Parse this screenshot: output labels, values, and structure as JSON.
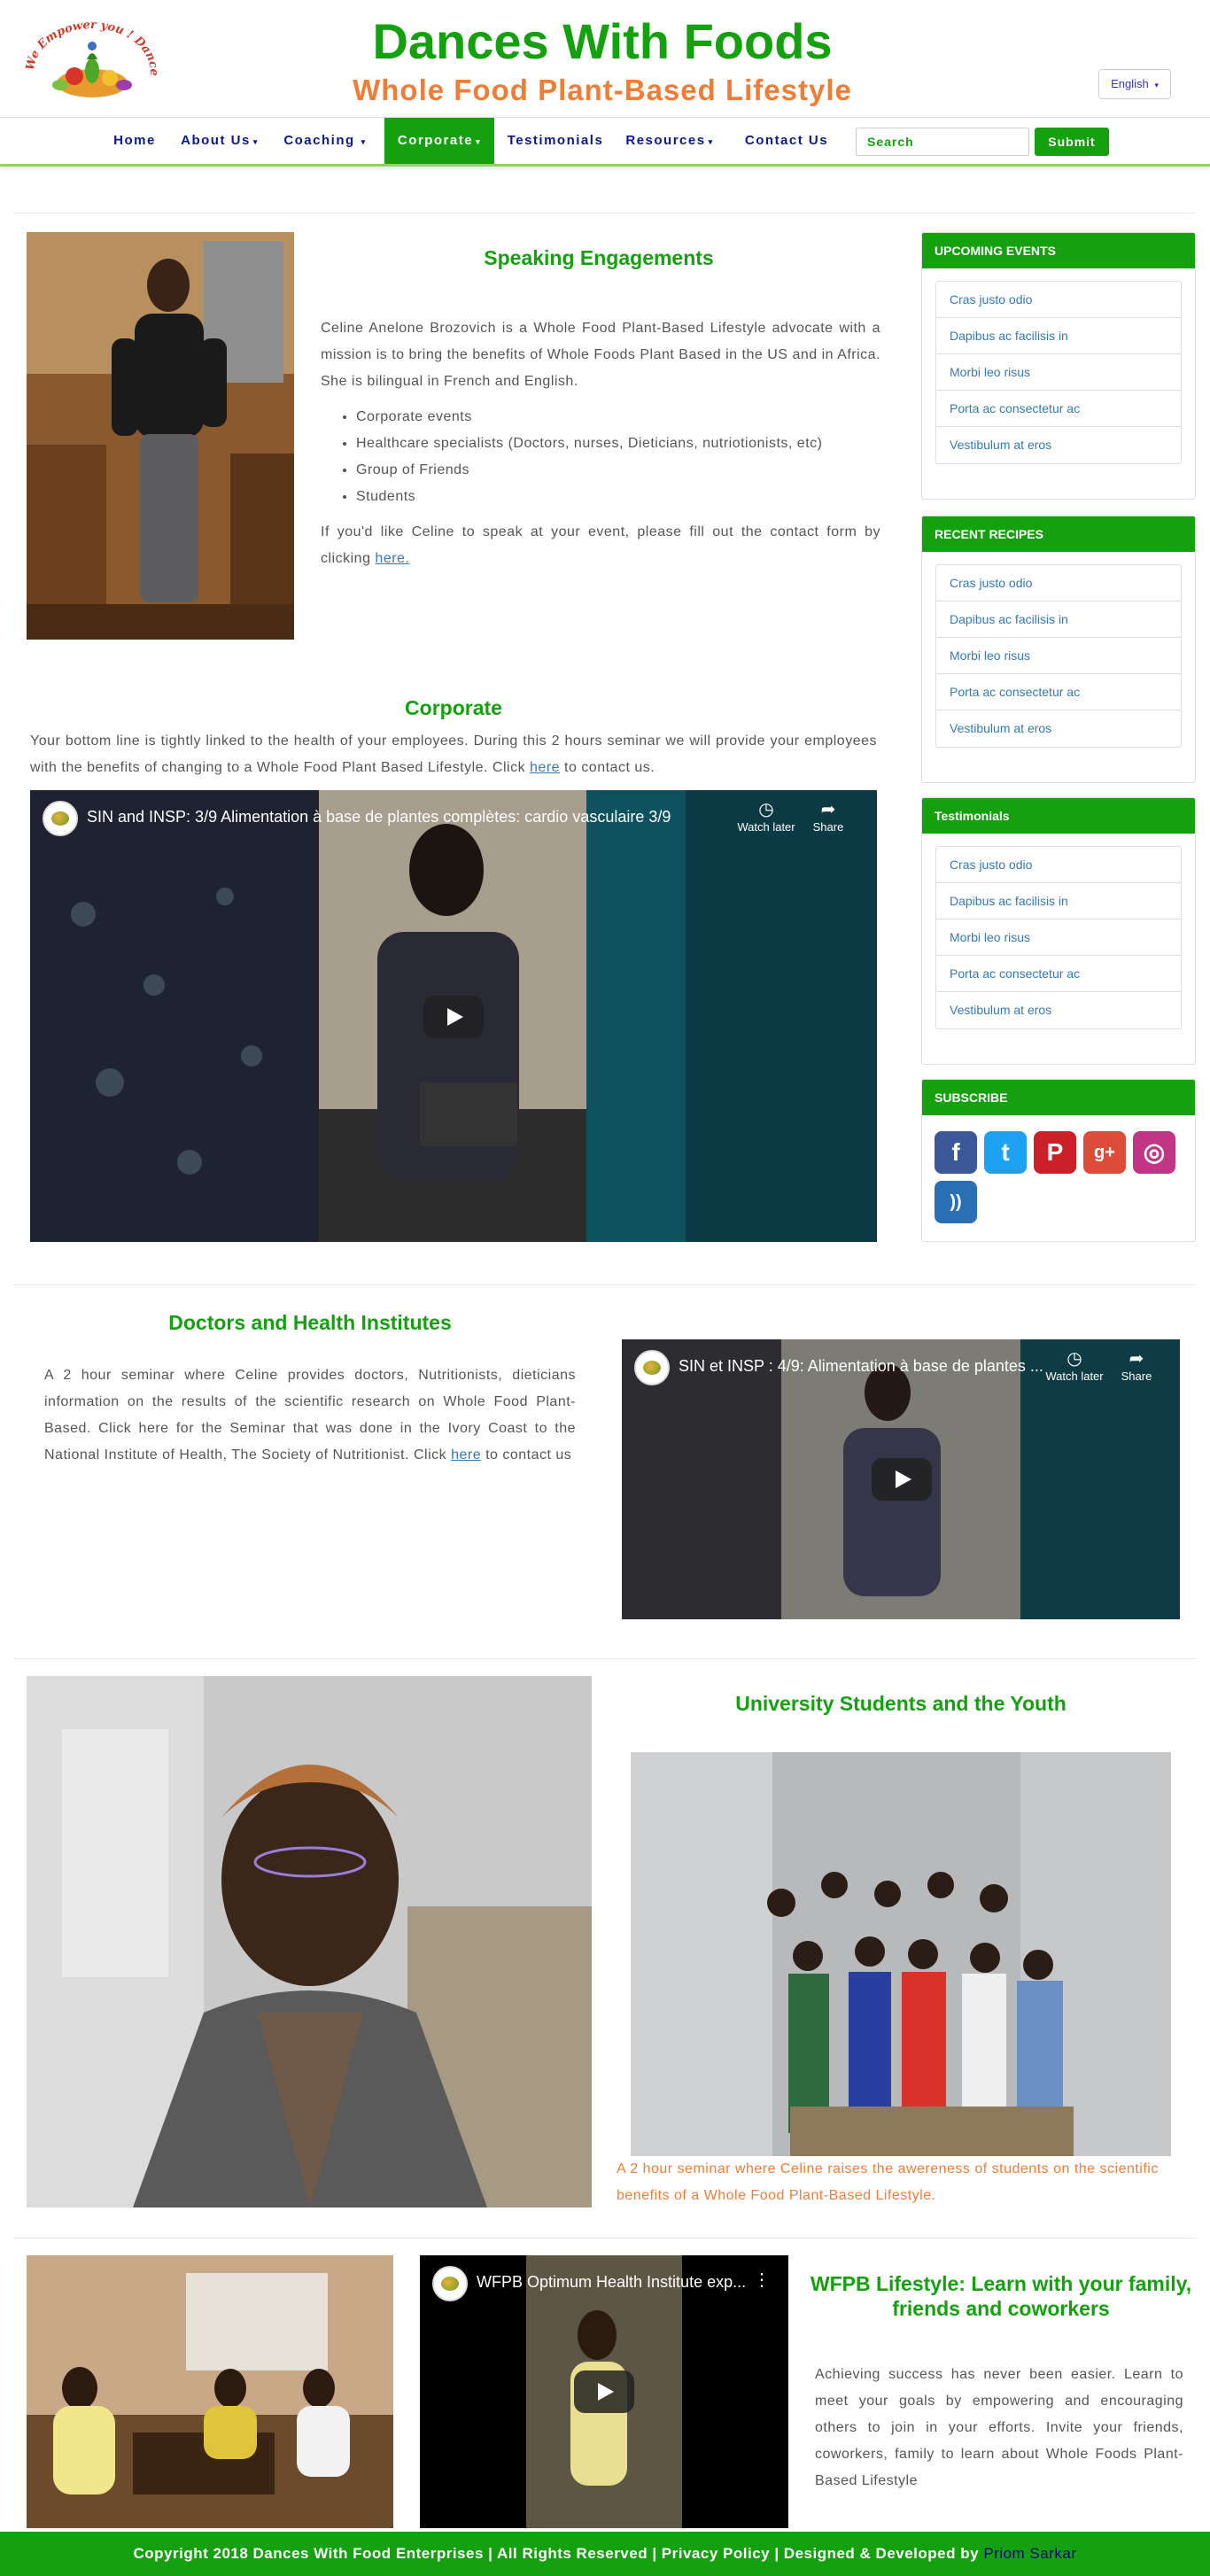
{
  "header": {
    "title": "Dances With Foods",
    "subtitle": "Whole Food Plant-Based Lifestyle",
    "logo_text": "We Empower you ! Dance With Foods",
    "language": "English"
  },
  "nav": {
    "items": [
      {
        "label": "Home"
      },
      {
        "label": "About Us"
      },
      {
        "label": "Coaching"
      },
      {
        "label": "Corporate"
      },
      {
        "label": "Testimonials"
      },
      {
        "label": "Resources"
      },
      {
        "label": "Contact Us"
      }
    ],
    "search_placeholder": "Search",
    "submit_label": "Submit"
  },
  "speaking": {
    "title": "Speaking Engagements",
    "intro": "Celine Anelone Brozovich is a Whole Food Plant-Based Lifestyle advocate with a mission is to bring the benefits of Whole Foods Plant Based in the US and in Africa. She is bilingual in French and English.",
    "bullets": [
      "Corporate events",
      "Healthcare specialists (Doctors, nurses, Dieticians, nutriotionists, etc)",
      "Group of Friends",
      "Students"
    ],
    "outro": "If you'd like Celine to speak at your event, please fill out the contact form by clicking",
    "link": "here."
  },
  "corporate": {
    "title": "Corporate",
    "text": "Your bottom line is tightly linked to the health of your employees. During this 2 hours seminar we will provide your employees with the benefits of changing to a Whole Food Plant Based Lifestyle. Click",
    "link": "here",
    "text_end": "to contact us.",
    "video_title": "SIN and INSP: 3/9 Alimentation à base de plantes complètes: cardio vasculaire 3/9",
    "watch_later": "Watch later",
    "share": "Share"
  },
  "doctors": {
    "title": "Doctors and Health Institutes",
    "text": "A 2 hour seminar where Celine provides doctors, Nutritionists, dieticians information on the results of the scientific research on Whole Food Plant-Based. Click here for the Seminar that was done in the Ivory Coast to the National Institute of Health, The Society of Nutritionist. Click",
    "link": "here",
    "text_end": "to contact us",
    "video_title": "SIN et INSP : 4/9: Alimentation à base de plantes ...",
    "watch_later": "Watch later",
    "share": "Share"
  },
  "students": {
    "title": "University Students and the Youth",
    "caption": "A 2 hour seminar where Celine raises the awereness of students on the scientific benefits of a Whole Food Plant-Based Lifestyle."
  },
  "wfpb": {
    "title": "WFPB Lifestyle: Learn with your family, friends and coworkers",
    "text": "Achieving success has never been easier. Learn to meet your goals by empowering and encouraging others to join in your efforts. Invite your friends, coworkers, family to learn about Whole Foods Plant-Based Lifestyle",
    "video_title": "WFPB Optimum Health Institute exp..."
  },
  "sidebar": {
    "upcoming": {
      "title": "UPCOMING EVENTS",
      "items": [
        "Cras justo odio",
        "Dapibus ac facilisis in",
        "Morbi leo risus",
        "Porta ac consectetur ac",
        "Vestibulum at eros"
      ]
    },
    "recipes": {
      "title": "RECENT RECIPES",
      "items": [
        "Cras justo odio",
        "Dapibus ac facilisis in",
        "Morbi leo risus",
        "Porta ac consectetur ac",
        "Vestibulum at eros"
      ]
    },
    "testimonials": {
      "title": "Testimonials",
      "items": [
        "Cras justo odio",
        "Dapibus ac facilisis in",
        "Morbi leo risus",
        "Porta ac consectetur ac",
        "Vestibulum at eros"
      ]
    },
    "subscribe": {
      "title": "SUBSCRIBE",
      "icons": [
        {
          "name": "facebook-icon",
          "glyph": "f",
          "color": "#3b5998"
        },
        {
          "name": "twitter-icon",
          "glyph": "t",
          "color": "#1da1f2"
        },
        {
          "name": "pinterest-icon",
          "glyph": "P",
          "color": "#cb2027"
        },
        {
          "name": "google-plus-icon",
          "glyph": "g+",
          "color": "#dd4b39"
        },
        {
          "name": "instagram-icon",
          "glyph": "◎",
          "color": "#c13584"
        },
        {
          "name": "rss-icon",
          "glyph": "))",
          "color": "#2a6fb3"
        }
      ]
    }
  },
  "footer": {
    "text": "Copyright 2018 Dances With Food Enterprises | All Rights Reserved | Privacy Policy | Designed & Developed by",
    "developer": "Priom Sarkar"
  }
}
